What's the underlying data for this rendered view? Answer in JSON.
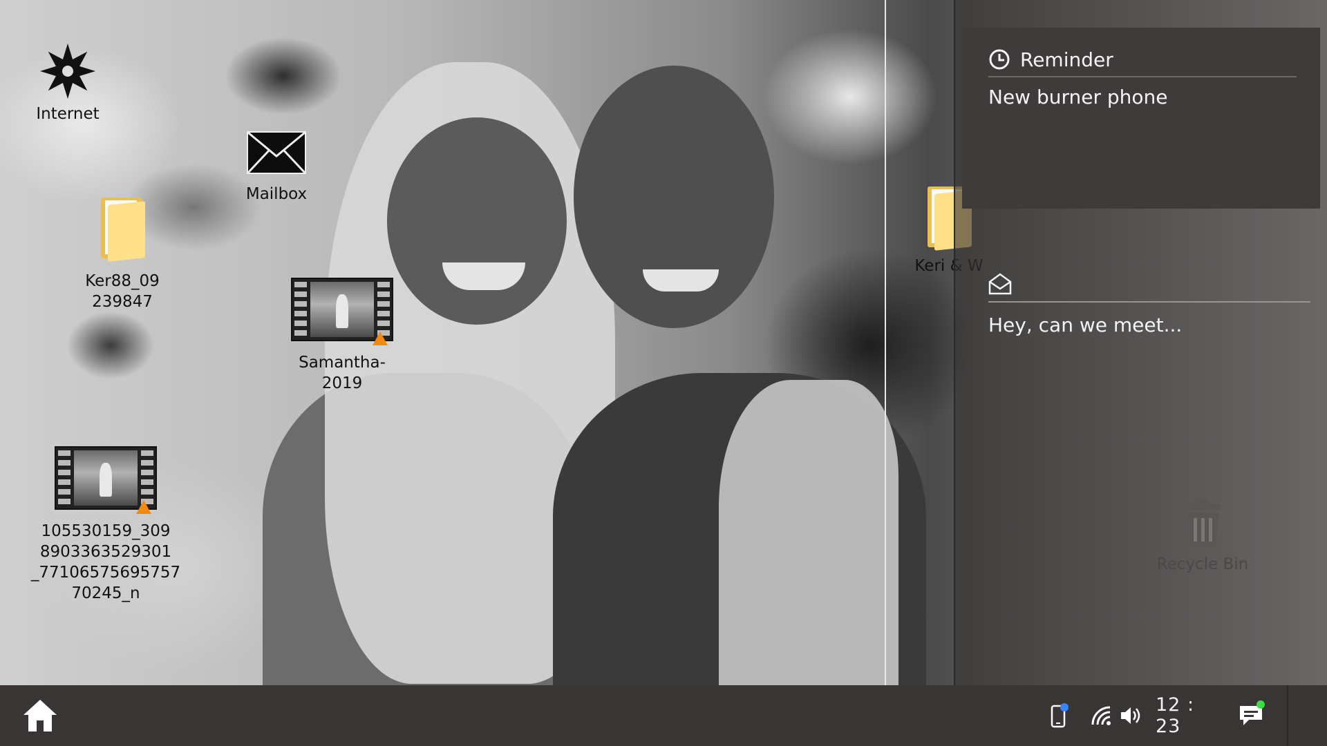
{
  "desktop": {
    "icons": [
      {
        "label": "Internet"
      },
      {
        "label": "Mailbox"
      },
      {
        "label": "Ker88_09\n239847"
      },
      {
        "label": "Samantha- 2019"
      },
      {
        "label": "105530159_309\n8903363529301\n_77106575695757\n70245_n"
      },
      {
        "label": "Keri & W"
      }
    ]
  },
  "notifications": {
    "reminder": {
      "title": "Reminder",
      "body": "New burner phone"
    },
    "message": {
      "body": "Hey, can we meet..."
    }
  },
  "recycle_bin": {
    "label": "Recycle Bin"
  },
  "taskbar": {
    "home_icon": "home-icon",
    "clock": "12 : 23",
    "icons": [
      "phone-icon",
      "wifi-icon",
      "volume-icon",
      "chat-icon"
    ],
    "colors": {
      "phone_badge": "#3a86ff",
      "chat_badge": "#3ddc47"
    }
  }
}
